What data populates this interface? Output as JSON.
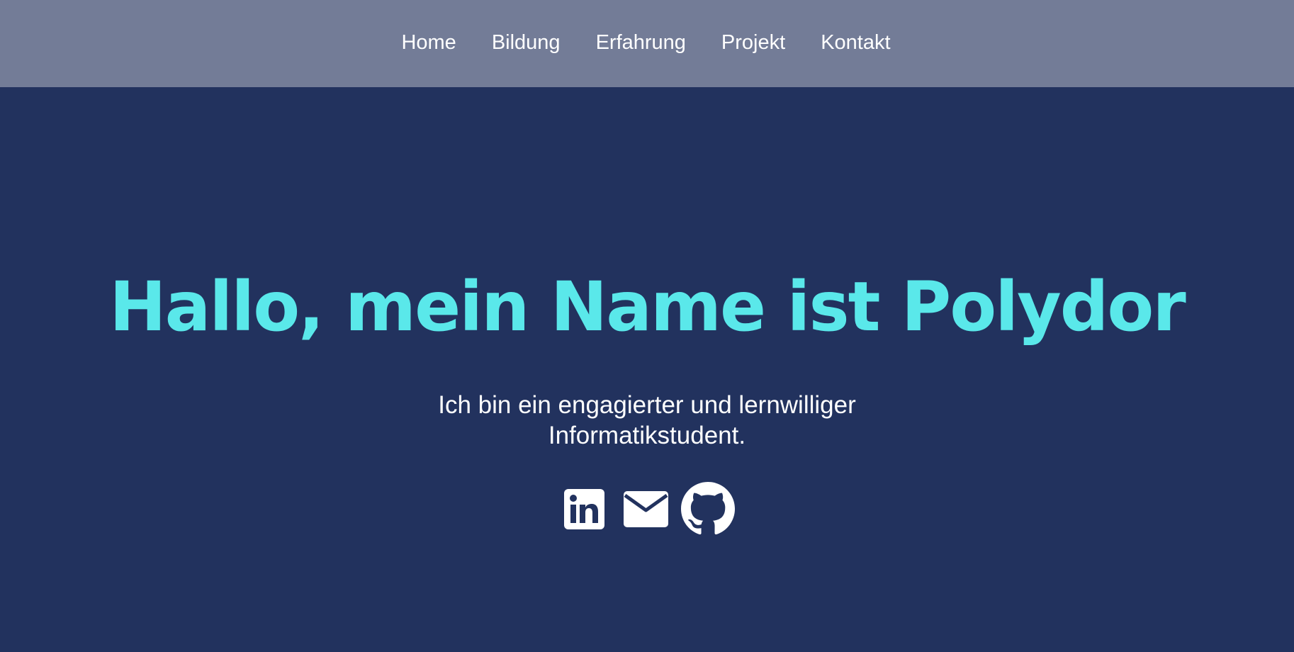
{
  "nav": {
    "items": [
      {
        "label": "Home"
      },
      {
        "label": "Bildung"
      },
      {
        "label": "Erfahrung"
      },
      {
        "label": "Projekt"
      },
      {
        "label": "Kontakt"
      }
    ]
  },
  "hero": {
    "title": "Hallo, mein Name ist Polydor",
    "subtitle": "Ich bin ein engagierter und lernwilliger Informatikstudent."
  },
  "social": {
    "icons": [
      "linkedin-icon",
      "mail-icon",
      "github-icon"
    ]
  },
  "colors": {
    "nav_background": "#737c97",
    "page_background": "#22325e",
    "title_accent": "#5ae8ea",
    "text": "#ffffff"
  }
}
